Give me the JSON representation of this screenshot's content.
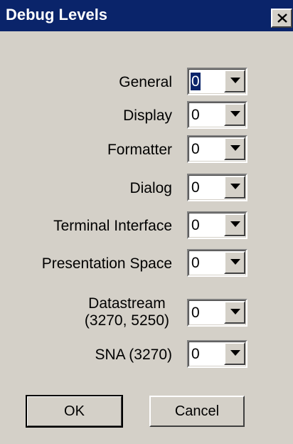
{
  "window": {
    "title": "Debug Levels",
    "close_symbol": "close-icon"
  },
  "rows": [
    {
      "label": "General",
      "value": "0",
      "focused": true
    },
    {
      "label": "Display",
      "value": "0"
    },
    {
      "label": "Formatter",
      "value": "0"
    },
    {
      "label": "Dialog",
      "value": "0"
    },
    {
      "label": "Terminal Interface",
      "value": "0"
    },
    {
      "label": "Presentation Space",
      "value": "0"
    },
    {
      "label_line1": "Datastream",
      "label_line2": "(3270, 5250)",
      "value": "0"
    },
    {
      "label": "SNA (3270)",
      "value": "0"
    }
  ],
  "buttons": {
    "ok": "OK",
    "cancel": "Cancel"
  },
  "colors": {
    "titlebar": "#0a246a",
    "face": "#d4d0c8",
    "selection": "#0a246a"
  }
}
